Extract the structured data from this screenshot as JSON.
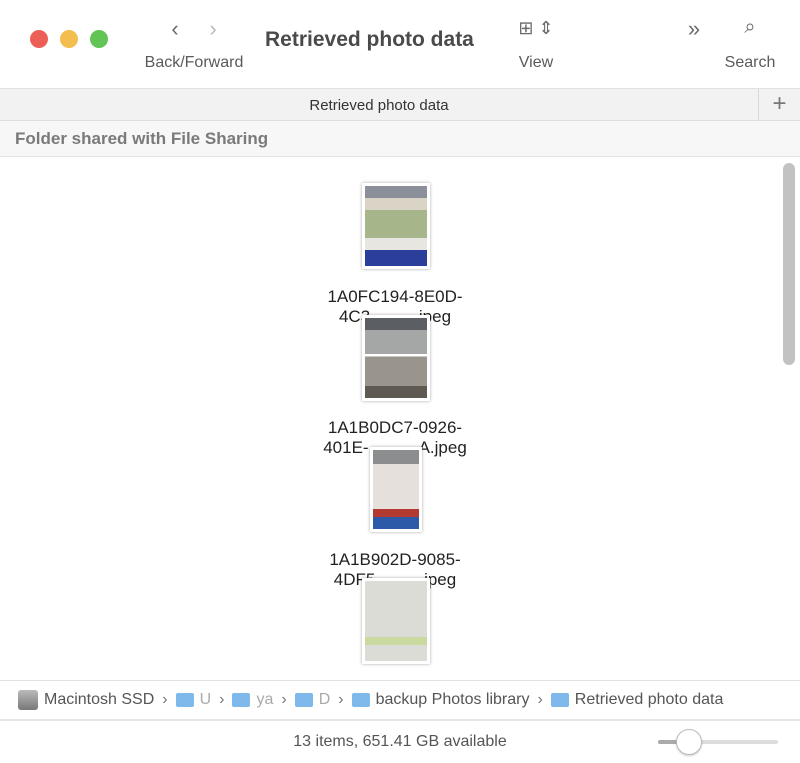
{
  "window": {
    "title": "Retrieved photo data"
  },
  "toolbar": {
    "back_forward_label": "Back/Forward",
    "view_label": "View",
    "search_label": "Search"
  },
  "tab": {
    "label": "Retrieved photo data"
  },
  "section": {
    "label": "Folder shared with File Sharing"
  },
  "files": [
    {
      "line1": "1A0FC194-8E0D-",
      "line2_start": "4C3",
      "line2_end": ".jpeg"
    },
    {
      "line1": "1A1B0DC7-0926-",
      "line2_start": "401E-",
      "line2_end": "A.jpeg"
    },
    {
      "line1": "1A1B902D-9085-",
      "line2_start": "4DF5",
      "line2_end": ".jpeg"
    }
  ],
  "path": {
    "items": [
      "Macintosh SSD",
      "U",
      "ya",
      "D",
      "backup Photos library",
      "Retrieved photo data"
    ]
  },
  "status": {
    "text": "13 items, 651.41 GB available",
    "icon_size_fraction": 0.2
  },
  "colors": {
    "close": "#ec5f57",
    "minimize": "#f3bd4f",
    "zoom": "#61c454",
    "folder": "#7fb8ea"
  }
}
